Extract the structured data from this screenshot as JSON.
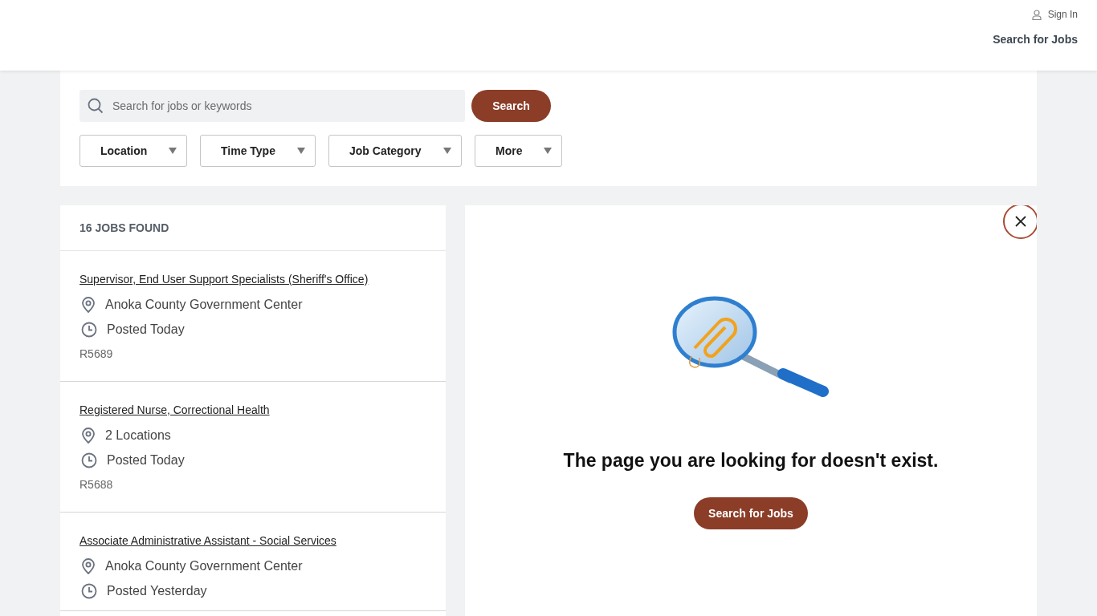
{
  "header": {
    "sign_in": "Sign In",
    "nav_link": "Search for Jobs"
  },
  "search": {
    "placeholder": "Search for jobs or keywords",
    "button": "Search"
  },
  "filters": [
    "Location",
    "Time Type",
    "Job Category",
    "More"
  ],
  "results": {
    "count": "16 JOBS FOUND",
    "jobs": [
      {
        "title": "Supervisor, End User Support Specialists (Sheriff's Office)",
        "location": "Anoka County Government Center",
        "posted": "Posted Today",
        "id": "R5689"
      },
      {
        "title": "Registered Nurse, Correctional Health",
        "location": "2 Locations",
        "posted": "Posted Today",
        "id": "R5688"
      },
      {
        "title": "Associate Administrative Assistant - Social Services",
        "location": "Anoka County Government Center",
        "posted": "Posted Yesterday"
      }
    ]
  },
  "error_panel": {
    "message": "The page you are looking for doesn't exist.",
    "button": "Search for Jobs"
  }
}
